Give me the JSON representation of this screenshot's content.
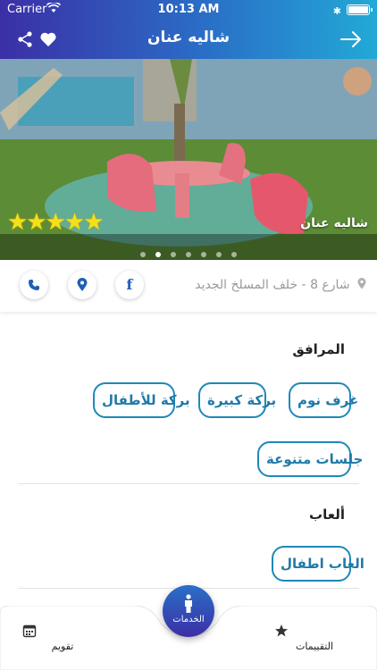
{
  "status_bar": {
    "carrier": "Carrier",
    "time": "10:13 AM"
  },
  "nav": {
    "title": "شاليه عنان",
    "icons": [
      "share-icon",
      "heart-icon",
      "arrow-right-icon"
    ]
  },
  "hero": {
    "caption": "شاليه عنان",
    "rating_stars": "★★★★★",
    "rating_value": 5,
    "slide_count": 7,
    "active_slide": 2
  },
  "info": {
    "address": "شارع 8 - خلف المسلخ الجديد",
    "actions": [
      "phone-icon",
      "location-icon",
      "facebook-icon"
    ],
    "facebook_glyph": "f"
  },
  "facilities": {
    "title": "المرافق",
    "items": [
      "غرف نوم",
      "بركة كبيرة",
      "بركة للأطفال",
      "جلسات متنوعة"
    ]
  },
  "games": {
    "title": "ألعاب",
    "items": [
      "العاب اطفال"
    ]
  },
  "tabbar": {
    "reviews_label": "التقييمات",
    "services_label": "الخدمات",
    "calendar_label": "تقويم"
  },
  "colors": {
    "nav_gradient_start": "#3b2fa6",
    "nav_gradient_end": "#22a9d6",
    "chip_border": "#1f88b8",
    "star": "#f4e01a"
  }
}
